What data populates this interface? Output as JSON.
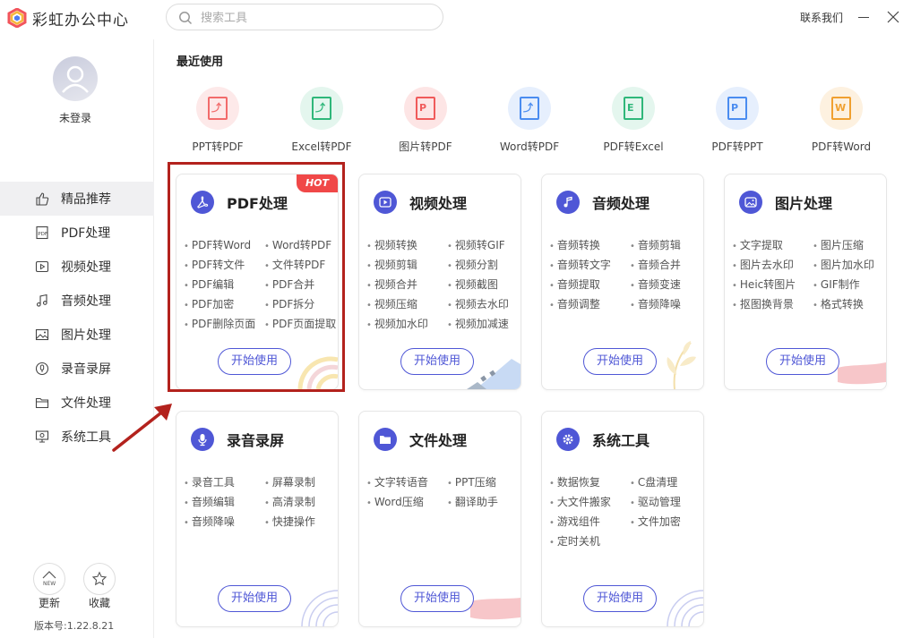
{
  "app": {
    "title": "彩虹办公中心"
  },
  "search": {
    "placeholder": "搜索工具"
  },
  "header": {
    "contact": "联系我们"
  },
  "sidebar": {
    "login": "未登录",
    "items": [
      {
        "label": "精品推荐",
        "icon": "thumbs-up-icon"
      },
      {
        "label": "PDF处理",
        "icon": "pdf-icon"
      },
      {
        "label": "视频处理",
        "icon": "video-icon"
      },
      {
        "label": "音频处理",
        "icon": "music-icon"
      },
      {
        "label": "图片处理",
        "icon": "image-icon"
      },
      {
        "label": "录音录屏",
        "icon": "record-icon"
      },
      {
        "label": "文件处理",
        "icon": "folder-icon"
      },
      {
        "label": "系统工具",
        "icon": "monitor-icon"
      }
    ],
    "update_label": "更新",
    "fav_label": "收藏",
    "version": "版本号:1.22.8.21"
  },
  "recent": {
    "title": "最近使用",
    "items": [
      {
        "label": "PPT转PDF",
        "glyph": "⤴",
        "color": "#f26b6b",
        "bg": "#fde9e9"
      },
      {
        "label": "Excel转PDF",
        "glyph": "⤴",
        "color": "#2fb77a",
        "bg": "#e4f6ee"
      },
      {
        "label": "图片转PDF",
        "glyph": "P",
        "color": "#f05a5a",
        "bg": "#fde5e5"
      },
      {
        "label": "Word转PDF",
        "glyph": "⤴",
        "color": "#4a8cf0",
        "bg": "#e6effd"
      },
      {
        "label": "PDF转Excel",
        "glyph": "E",
        "color": "#2fb77a",
        "bg": "#e4f6ee"
      },
      {
        "label": "PDF转PPT",
        "glyph": "P",
        "color": "#4a8cf0",
        "bg": "#e6effd"
      },
      {
        "label": "PDF转Word",
        "glyph": "W",
        "color": "#f0a030",
        "bg": "#fdf1e0"
      }
    ]
  },
  "cards": [
    {
      "title": "PDF处理",
      "hot": "HOT",
      "button": "开始使用",
      "items": [
        "PDF转Word",
        "Word转PDF",
        "PDF转文件",
        "文件转PDF",
        "PDF编辑",
        "PDF合并",
        "PDF加密",
        "PDF拆分",
        "PDF删除页面",
        "PDF页面提取"
      ]
    },
    {
      "title": "视频处理",
      "button": "开始使用",
      "items": [
        "视频转换",
        "视频转GIF",
        "视频剪辑",
        "视频分割",
        "视频合并",
        "视频截图",
        "视频压缩",
        "视频去水印",
        "视频加水印",
        "视频加减速"
      ]
    },
    {
      "title": "音频处理",
      "button": "开始使用",
      "items": [
        "音频转换",
        "音频剪辑",
        "音频转文字",
        "音频合并",
        "音频提取",
        "音频变速",
        "音频调整",
        "音频降噪"
      ]
    },
    {
      "title": "图片处理",
      "button": "开始使用",
      "items": [
        "文字提取",
        "图片压缩",
        "图片去水印",
        "图片加水印",
        "Heic转图片",
        "GIF制作",
        "抠图换背景",
        "格式转换"
      ]
    },
    {
      "title": "录音录屏",
      "button": "开始使用",
      "items": [
        "录音工具",
        "屏幕录制",
        "音频编辑",
        "高清录制",
        "音频降噪",
        "快捷操作"
      ]
    },
    {
      "title": "文件处理",
      "button": "开始使用",
      "items": [
        "文字转语音",
        "PPT压缩",
        "Word压缩",
        "翻译助手"
      ]
    },
    {
      "title": "系统工具",
      "button": "开始使用",
      "items": [
        "数据恢复",
        "C盘清理",
        "大文件搬家",
        "驱动管理",
        "游戏组件",
        "文件加密",
        "定时关机"
      ]
    }
  ],
  "colors": {
    "accent": "#4f57d6",
    "highlight": "#b3221d",
    "hot": "#f04848"
  }
}
